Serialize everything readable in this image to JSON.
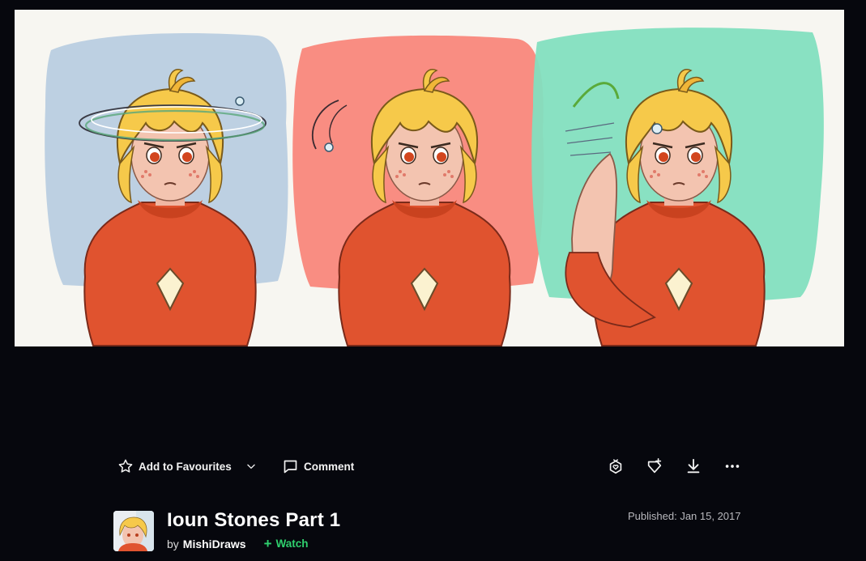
{
  "artwork": {
    "panel_colors": [
      "#b9cde0",
      "#f9877b",
      "#83dfbf"
    ],
    "hair_color": "#f6c94a",
    "shirt_color": "#e0532f"
  },
  "actions": {
    "favourite_label": "Add to Favourites",
    "comment_label": "Comment",
    "icons": [
      "star-icon",
      "chevron-down-icon",
      "comment-icon",
      "gift-icon",
      "badge-add-icon",
      "download-icon",
      "more-icon"
    ]
  },
  "deviation": {
    "title": "Ioun Stones Part 1",
    "by_label": "by",
    "author": "MishiDraws",
    "watch_label": "Watch",
    "published": "Published: Jan 15, 2017"
  }
}
